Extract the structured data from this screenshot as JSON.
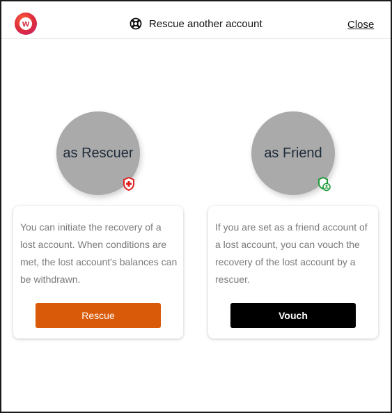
{
  "header": {
    "logo_letter": "w",
    "title": "Rescue another account",
    "title_icon": "lifebuoy-icon",
    "close_label": "Close"
  },
  "options": [
    {
      "circle_label": "as Rescuer",
      "badge_icon": "shield-plus-icon",
      "badge_color": "#e02020",
      "description": "You can initiate the recovery of a lost account. When conditions are met, the lost account's balances can be withdrawn.",
      "button_label": "Rescue",
      "button_color": "#d95a08"
    },
    {
      "circle_label": "as Friend",
      "badge_icon": "shield-user-icon",
      "badge_color": "#1f9a3a",
      "description": "If you are set as a friend account of a lost account, you can vouch the recovery of the lost account by a rescuer.",
      "button_label": "Vouch",
      "button_color": "#000000"
    }
  ]
}
